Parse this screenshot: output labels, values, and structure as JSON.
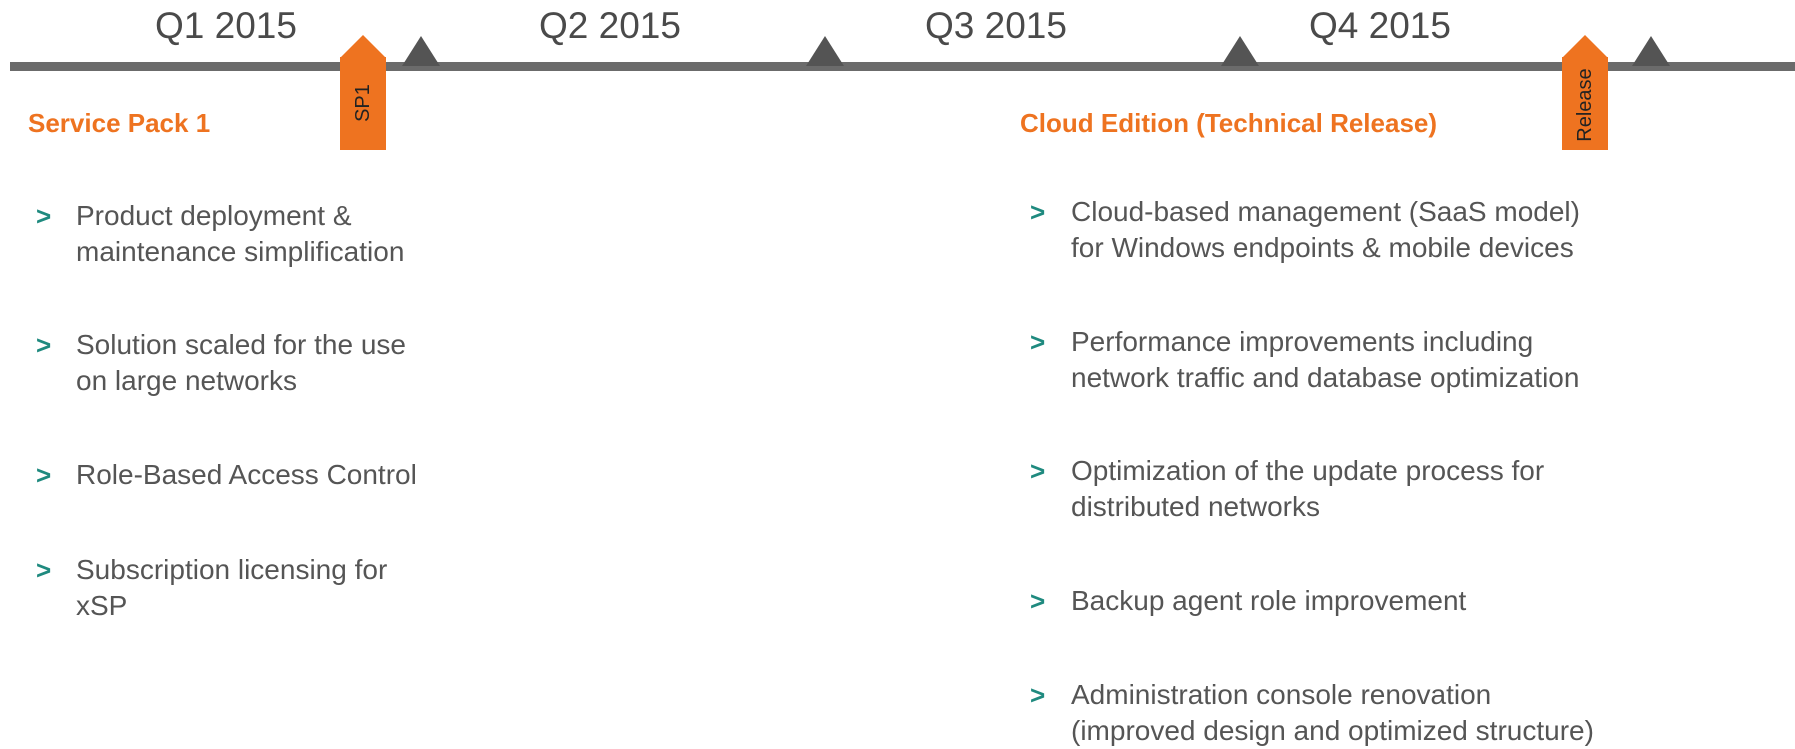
{
  "timeline": {
    "quarters": [
      {
        "label": "Q1 2015"
      },
      {
        "label": "Q2 2015"
      },
      {
        "label": "Q3 2015"
      },
      {
        "label": "Q4 2015"
      }
    ],
    "markers": [
      {
        "label": "SP1",
        "color": "#ee7320"
      },
      {
        "label": "Release",
        "color": "#ee7320"
      }
    ]
  },
  "sections": [
    {
      "title": "Service Pack 1",
      "bullets": [
        "Product deployment &\nmaintenance simplification",
        "Solution scaled for the use\non large networks",
        "Role-Based Access Control",
        "Subscription licensing for\nxSP"
      ]
    },
    {
      "title": "Cloud Edition (Technical Release)",
      "bullets": [
        "Cloud-based management (SaaS model)\nfor Windows endpoints & mobile devices",
        "Performance improvements including\nnetwork traffic and database optimization",
        "Optimization of the update process for\ndistributed networks",
        "Backup agent role improvement",
        "Administration console renovation\n(improved design and optimized structure)"
      ]
    }
  ],
  "colors": {
    "accent": "#ee7320",
    "chevron": "#1f8a7f",
    "timeline": "#6b6b6b",
    "text": "#555555"
  },
  "icons": {
    "bullet": "chevron-right-icon"
  }
}
